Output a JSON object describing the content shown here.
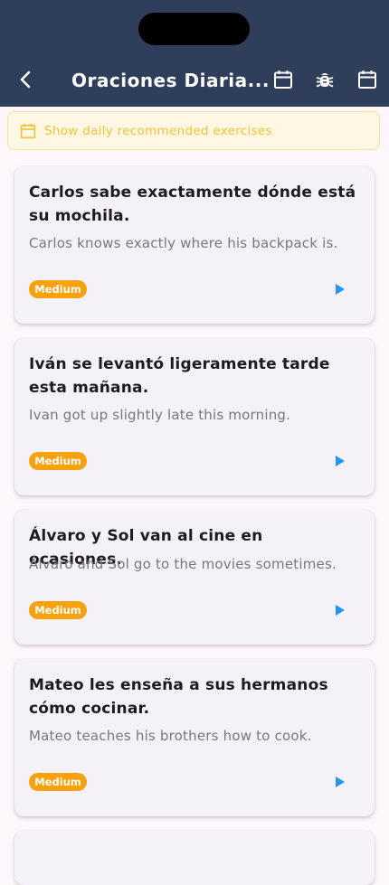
{
  "header": {
    "title": "Oraciones Diaria...",
    "back_icon": "back-arrow-icon",
    "actions": [
      "calendar-icon",
      "bug-icon",
      "calendar-icon"
    ]
  },
  "banner": {
    "icon": "calendar-icon",
    "text": "Show daily recommended exercises"
  },
  "colors": {
    "appbar": "#2f3e5b",
    "badge": "#f7a10d",
    "play": "#2196f3",
    "banner_text": "#f1c232"
  },
  "cards": [
    {
      "spanish": "Carlos sabe exactamente dónde está su mochila.",
      "english": "Carlos knows exactly where his backpack is.",
      "level": "Medium"
    },
    {
      "spanish": "Iván se levantó ligeramente tarde esta mañana.",
      "english": "Ivan got up slightly late this morning.",
      "level": "Medium"
    },
    {
      "spanish": "Álvaro y Sol van al cine en ocasiones.",
      "english": "Álvaro and Sol go to the movies sometimes.",
      "level": "Medium"
    },
    {
      "spanish": "Mateo les enseña a sus hermanos cómo cocinar.",
      "english": "Mateo teaches his brothers how to cook.",
      "level": "Medium"
    }
  ]
}
